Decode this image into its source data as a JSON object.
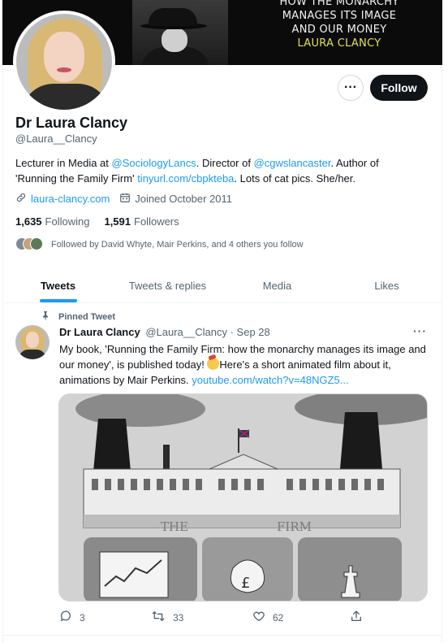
{
  "banner": {
    "lines": [
      "HOW THE MONARCHY",
      "MANAGES ITS IMAGE",
      "AND OUR MONEY"
    ],
    "author": "LAURA CLANCY"
  },
  "profile": {
    "name": "Dr Laura Clancy",
    "handle": "@Laura__Clancy",
    "follow_label": "Follow",
    "bio": {
      "t1": "Lecturer in Media at ",
      "l1": "@SociologyLancs",
      "t2": ". Director of ",
      "l2": "@cgwslancaster",
      "t3": ". Author of 'Running the Family Firm' ",
      "l3": "tinyurl.com/cbpkteba",
      "t4": ". Lots of cat pics. She/her."
    },
    "website": "laura-clancy.com",
    "joined": "Joined October 2011",
    "following_count": "1,635",
    "following_label": "Following",
    "followers_count": "1,591",
    "followers_label": "Followers",
    "followed_by": "Followed by David Whyte, Mair Perkins, and 4 others you follow"
  },
  "tabs": [
    "Tweets",
    "Tweets & replies",
    "Media",
    "Likes"
  ],
  "tweet": {
    "pinned_label": "Pinned Tweet",
    "author": "Dr Laura Clancy",
    "handle": "@Laura__Clancy",
    "sep": " · ",
    "date": "Sep 28",
    "text_before": "My book, 'Running the Family Firm: how the monarchy manages its image and our money', is published today! ",
    "text_after": "Here's a short animated film about it, animations by Mair Perkins. ",
    "link": "youtube.com/watch?v=48NGZ5...",
    "media_sign_left": "THE",
    "media_sign_right": "FIRM",
    "replies": "3",
    "retweets": "33",
    "likes": "62"
  },
  "icons": [
    "more-icon",
    "link-icon",
    "calendar-icon",
    "pin-icon",
    "reply-icon",
    "retweet-icon",
    "like-icon",
    "share-icon"
  ],
  "colors": {
    "accent": "#1d9bf0",
    "text": "#0f1419",
    "muted": "#536471",
    "follow_bg": "#0f1419",
    "banner_author": "#e3e04f"
  }
}
